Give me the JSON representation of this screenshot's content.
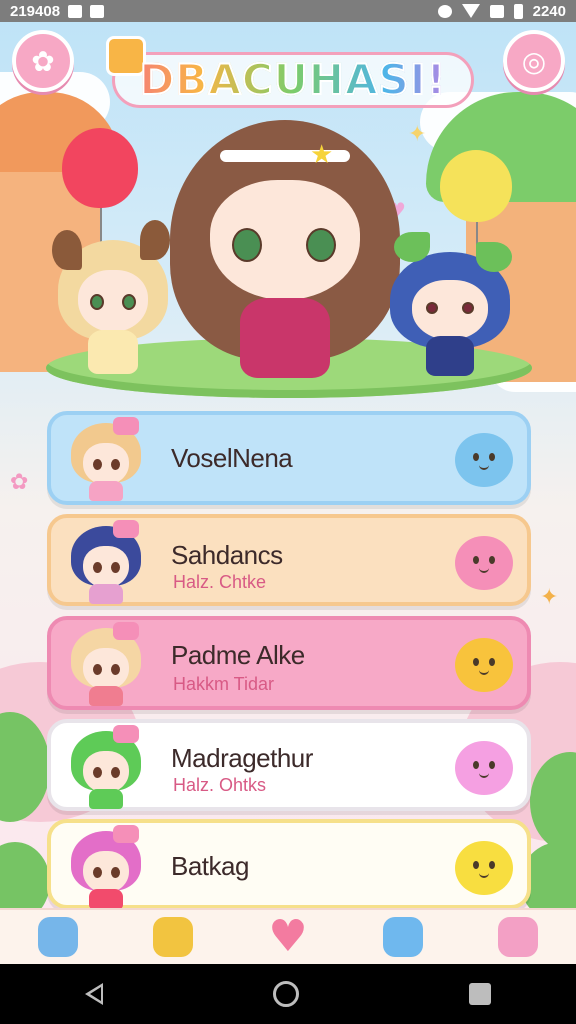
{
  "status_bar": {
    "left_text": "219408",
    "right_text": "2240",
    "icons": [
      "hourglass-icon",
      "camera-icon",
      "alarm-icon",
      "signal-icon",
      "wifi-icon",
      "battery-icon"
    ]
  },
  "header": {
    "title": "DBACUHASI!",
    "left_button_icon": "paw-icon",
    "right_button_icon": "swirl-icon"
  },
  "characters": [
    {
      "name": "",
      "role": "Blonde fox-ear girl",
      "hair_color": "#f3d9a0"
    },
    {
      "name": "",
      "role": "Brown-haired heroine",
      "hair_color": "#8a5a44"
    },
    {
      "name": "",
      "role": "Blue-haired leaf girl",
      "hair_color": "#3f5fb6"
    }
  ],
  "list": {
    "items": [
      {
        "name": "VoselNena",
        "sub": "",
        "bg": "#bfe3f9",
        "border": "#9cd0f3",
        "hair": "#f2c98e",
        "body": "#f6a3c4",
        "pet": "#7cc4ee",
        "pet_icon": "blue-blob-icon"
      },
      {
        "name": "Sahdancs",
        "sub": "Halz. Chtke",
        "bg": "#fbe0bf",
        "border": "#f6c88e",
        "hair": "#3b4a9c",
        "body": "#e6a0d0",
        "pet": "#f58fb8",
        "pet_icon": "star-flower-icon"
      },
      {
        "name": "Padme Alke",
        "sub": "Hakkm Tidar",
        "bg": "#f7a9c7",
        "border": "#ee8ab2",
        "hair": "#f5d6a4",
        "body": "#f07d90",
        "pet": "#f8c33c",
        "pet_icon": "yellow-chick-icon"
      },
      {
        "name": "Madragethur",
        "sub": "Halz. Ohtks",
        "bg": "#ffffff",
        "border": "#e8e4ea",
        "hair": "#5ecb57",
        "body": "#5ecb57",
        "pet": "#f5a0e2",
        "pet_icon": "pink-blob-icon"
      },
      {
        "name": "Batkag",
        "sub": "",
        "bg": "#fffdf4",
        "border": "#f6e08a",
        "hair": "#e36ec8",
        "body": "#f24b6c",
        "pet": "#f8de40",
        "pet_icon": "yellow-blob-icon"
      }
    ]
  },
  "tabbar": {
    "tabs": [
      {
        "icon": "robot-icon",
        "color": "#76b6ea"
      },
      {
        "icon": "lantern-icon",
        "color": "#f2c440"
      },
      {
        "icon": "heart-icon",
        "color": "#f37ba0",
        "glyph": "♥"
      },
      {
        "icon": "blue-blob-icon",
        "color": "#6fb8ee"
      },
      {
        "icon": "pink-bunny-icon",
        "color": "#f3a0c5"
      }
    ]
  },
  "navbar": {
    "buttons": [
      "back-icon",
      "home-icon",
      "recents-icon"
    ]
  }
}
